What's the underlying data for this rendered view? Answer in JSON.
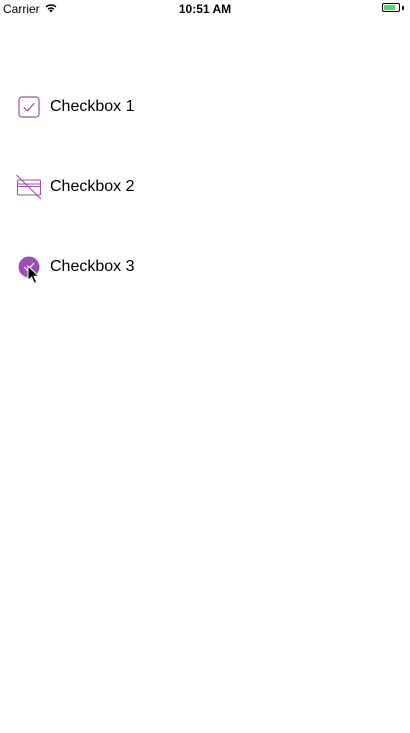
{
  "status_bar": {
    "carrier": "Carrier",
    "time": "10:51 AM",
    "battery_level": 0.8,
    "battery_color": "#4cd964"
  },
  "accent_color": "#9b4fb4",
  "checkboxes": [
    {
      "label": "Checkbox 1",
      "icon": "checkbox-square-checked-icon",
      "checked": true
    },
    {
      "label": "Checkbox 2",
      "icon": "card-disabled-icon",
      "checked": false
    },
    {
      "label": "Checkbox 3",
      "icon": "checkbox-circle-checked-icon",
      "checked": true
    }
  ]
}
